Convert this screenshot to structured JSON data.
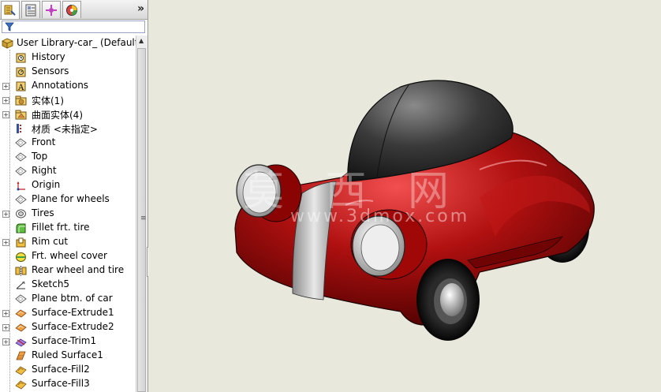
{
  "tree": {
    "root": "User Library-car_ (Default",
    "items": [
      {
        "label": "History",
        "icon": "history-folder-icon",
        "expandable": false
      },
      {
        "label": "Sensors",
        "icon": "sensors-icon",
        "expandable": false
      },
      {
        "label": "Annotations",
        "icon": "annotations-icon",
        "expandable": true
      },
      {
        "label": "实体(1)",
        "icon": "solid-bodies-folder-icon",
        "expandable": true
      },
      {
        "label": "曲面实体(4)",
        "icon": "surface-bodies-folder-icon",
        "expandable": true
      },
      {
        "label": "材质 <未指定>",
        "icon": "material-icon",
        "expandable": false
      },
      {
        "label": "Front",
        "icon": "plane-icon",
        "expandable": false
      },
      {
        "label": "Top",
        "icon": "plane-icon",
        "expandable": false
      },
      {
        "label": "Right",
        "icon": "plane-icon",
        "expandable": false
      },
      {
        "label": "Origin",
        "icon": "origin-icon",
        "expandable": false
      },
      {
        "label": "Plane for wheels",
        "icon": "plane-icon",
        "expandable": false
      },
      {
        "label": "Tires",
        "icon": "revolve-feature-icon",
        "expandable": true
      },
      {
        "label": "Fillet frt. tire",
        "icon": "fillet-icon",
        "expandable": false
      },
      {
        "label": "Rim cut",
        "icon": "cut-icon",
        "expandable": true
      },
      {
        "label": "Frt. wheel cover",
        "icon": "wheel-cover-icon",
        "expandable": false
      },
      {
        "label": "Rear wheel and tire",
        "icon": "mirror-feature-icon",
        "expandable": false
      },
      {
        "label": "Sketch5",
        "icon": "sketch-icon",
        "expandable": false
      },
      {
        "label": "Plane btm. of car",
        "icon": "plane-icon",
        "expandable": false
      },
      {
        "label": "Surface-Extrude1",
        "icon": "surface-extrude-icon",
        "expandable": true
      },
      {
        "label": "Surface-Extrude2",
        "icon": "surface-extrude-icon",
        "expandable": true
      },
      {
        "label": "Surface-Trim1",
        "icon": "surface-trim-icon",
        "expandable": true
      },
      {
        "label": "Ruled Surface1",
        "icon": "ruled-surface-icon",
        "expandable": false
      },
      {
        "label": "Surface-Fill2",
        "icon": "surface-fill-icon",
        "expandable": false
      },
      {
        "label": "Surface-Fill3",
        "icon": "surface-fill-icon",
        "expandable": false
      }
    ]
  },
  "watermark": {
    "main": "莫 西 网",
    "sub": "www.3dmox.com"
  },
  "colors": {
    "car_body": "#9a0a0a",
    "roof": "#3a3a3a",
    "stripe": "#cfcfcf",
    "viewport_bg": "#e9e8dc"
  }
}
